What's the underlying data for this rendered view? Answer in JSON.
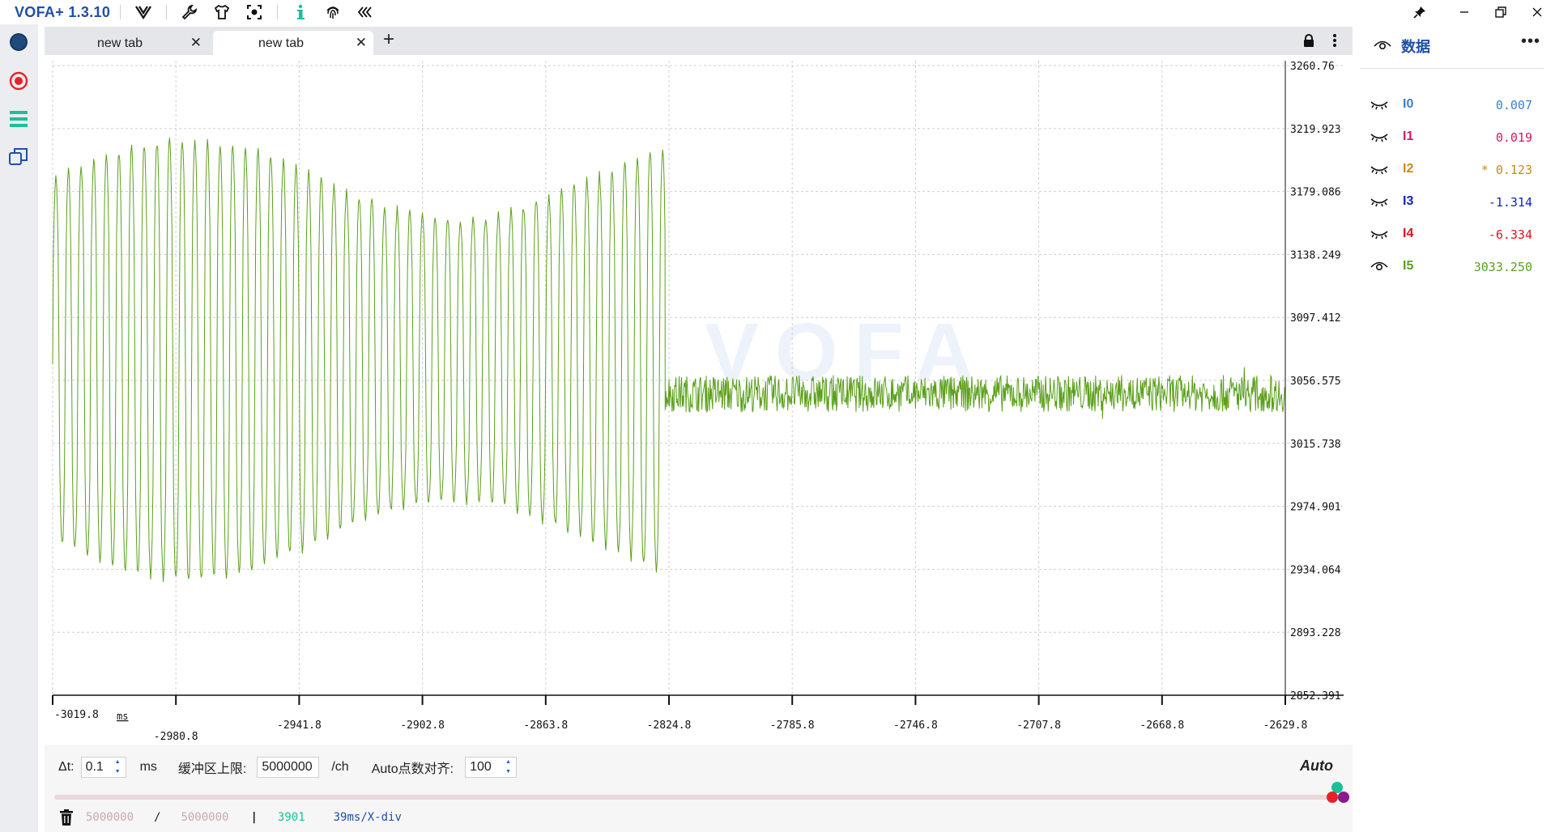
{
  "app": {
    "title": "VOFA+ 1.3.10"
  },
  "tabs": [
    {
      "label": "new tab",
      "active": false
    },
    {
      "label": "new tab",
      "active": true
    }
  ],
  "chart_data": {
    "type": "line",
    "y_ticks": [
      "3260.76",
      "3219.923",
      "3179.086",
      "3138.249",
      "3097.412",
      "3056.575",
      "3015.738",
      "2974.901",
      "2934.064",
      "2893.228",
      "2852.391"
    ],
    "ylim": [
      2852.391,
      3260.76
    ],
    "x_ticks": [
      "-3019.8",
      "-2980.8",
      "-2941.8",
      "-2902.8",
      "-2863.8",
      "-2824.8",
      "-2785.8",
      "-2746.8",
      "-2707.8",
      "-2668.8",
      "-2629.8"
    ],
    "xlim": [
      -3019.8,
      -2629.8
    ],
    "xunit": "ms",
    "series": [
      {
        "name": "I5",
        "color": "#5aa01a",
        "segments": [
          {
            "x_start": -3019.8,
            "x_end": -2826.0,
            "shape": "oscillation",
            "min": 2927.0,
            "max": 3213.0,
            "period_ms": 4.0
          },
          {
            "x_start": -2826.0,
            "x_end": -2630.0,
            "shape": "noise",
            "center": 3048.0,
            "amplitude": 12.0
          }
        ]
      }
    ]
  },
  "watermark": "VOFA",
  "channels": [
    {
      "name": "I0",
      "value": "0.007",
      "color": "#3d7fd0",
      "visible": false
    },
    {
      "name": "I1",
      "value": "0.019",
      "color": "#d6156b",
      "visible": false
    },
    {
      "name": "I2",
      "value": "* 0.123",
      "color": "#c98a10",
      "visible": false
    },
    {
      "name": "I3",
      "value": "-1.314",
      "color": "#1322c9",
      "visible": false
    },
    {
      "name": "I4",
      "value": "-6.334",
      "color": "#e0131f",
      "visible": false
    },
    {
      "name": "I5",
      "value": "3033.250",
      "color": "#5aa01a",
      "visible": true
    }
  ],
  "right_panel": {
    "title": "数据"
  },
  "controls": {
    "dt_label": "Δt:",
    "dt_value": "0.1",
    "dt_unit": "ms",
    "buffer_label": "缓冲区上限:",
    "buffer_value": "5000000",
    "buffer_unit": "/ch",
    "auto_align_label": "Auto点数对齐:",
    "auto_align_value": "100",
    "auto_label": "Auto"
  },
  "status": {
    "count_a": "5000000",
    "slash": "/",
    "count_b": "5000000",
    "sep": "|",
    "points": "3901",
    "xdiv": "39ms/X-div"
  },
  "colors": {
    "accent": "#1f4fa8",
    "slider_teal": "#1bbf9a",
    "slider_red": "#e8202a",
    "slider_purple": "#8a1b8f"
  }
}
